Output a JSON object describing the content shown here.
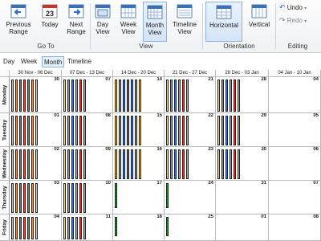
{
  "ribbon": {
    "goto": {
      "previous": "Previous\nRange",
      "today": "Today",
      "today_date": "23",
      "next": "Next\nRange",
      "label": "Go To"
    },
    "view": {
      "day": "Day\nView",
      "week": "Week\nView",
      "month": "Month\nView",
      "timeline": "Timeline\nView",
      "label": "View"
    },
    "orientation": {
      "horizontal": "Horizontal",
      "vertical": "Vertical",
      "label": "Orientation"
    },
    "editing": {
      "undo": "Undo",
      "redo": "Redo",
      "label": "Editing"
    }
  },
  "tabs": [
    "Day",
    "Week",
    "Month",
    "Timeline"
  ],
  "selected_tab": "Month",
  "columns": [
    "30 Nov - 06 Dec",
    "07 Dec - 13 Dec",
    "14 Dec - 20 Dec",
    "21 Dec - 27 Dec",
    "28 Dec - 03 Jan",
    "04 Jan - 10 Jan"
  ],
  "rows": [
    {
      "day": "Monday",
      "dates": [
        "30",
        "07",
        "14",
        "21",
        "28",
        "04"
      ]
    },
    {
      "day": "Tuesday",
      "dates": [
        "01",
        "08",
        "15",
        "22",
        "29",
        "05"
      ]
    },
    {
      "day": "Wednesday",
      "dates": [
        "02",
        "09",
        "16",
        "23",
        "30",
        "06"
      ]
    },
    {
      "day": "Thursday",
      "dates": [
        "03",
        "10",
        "17",
        "24",
        "31",
        "07"
      ]
    },
    {
      "day": "Friday",
      "dates": [
        "04",
        "11",
        "18",
        "25",
        "01",
        "08"
      ]
    }
  ],
  "colors": {
    "yellow": "#f5c518",
    "orange": "#f08a24",
    "blue": "#3b7ddd",
    "red": "#e0402a",
    "cream": "#f4e3b5",
    "salmon": "#e8987a",
    "green": "#2e9e3a",
    "accent": "#2b6fc4"
  }
}
